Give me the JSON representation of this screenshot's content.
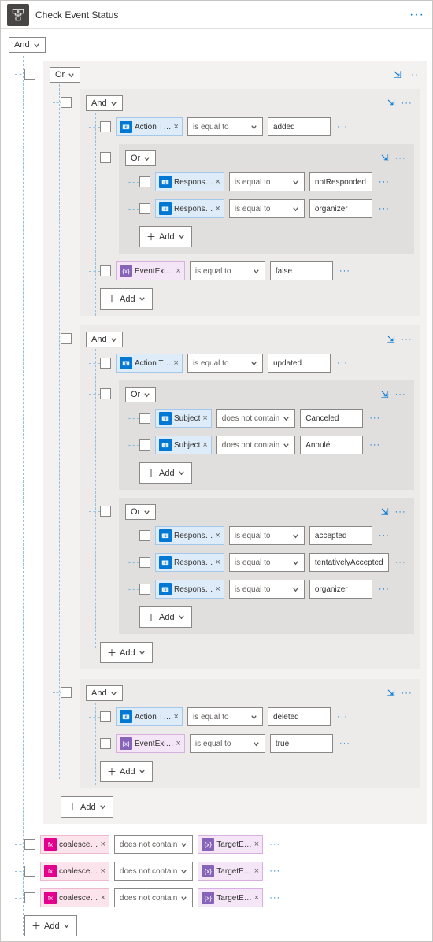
{
  "header": {
    "title": "Check Event Status"
  },
  "labels": {
    "and": "And",
    "or": "Or",
    "add": "Add"
  },
  "operators": {
    "eq": "is equal to",
    "notcontain": "does not contain"
  },
  "tokens": {
    "actionType": "Action T…",
    "response": "Respons…",
    "eventExists": "EventExi…",
    "subject": "Subject",
    "coalesce": "coalesce…",
    "targetE": "TargetE…"
  },
  "values": {
    "added": "added",
    "notResponded": "notResponded",
    "organizer": "organizer",
    "updated": "updated",
    "canceled": "Canceled",
    "annule": "Annulé",
    "accepted": "accepted",
    "tentatively": "tentativelyAccepted",
    "deleted": "deleted",
    "vtrue": "true",
    "vfalse": "false"
  }
}
